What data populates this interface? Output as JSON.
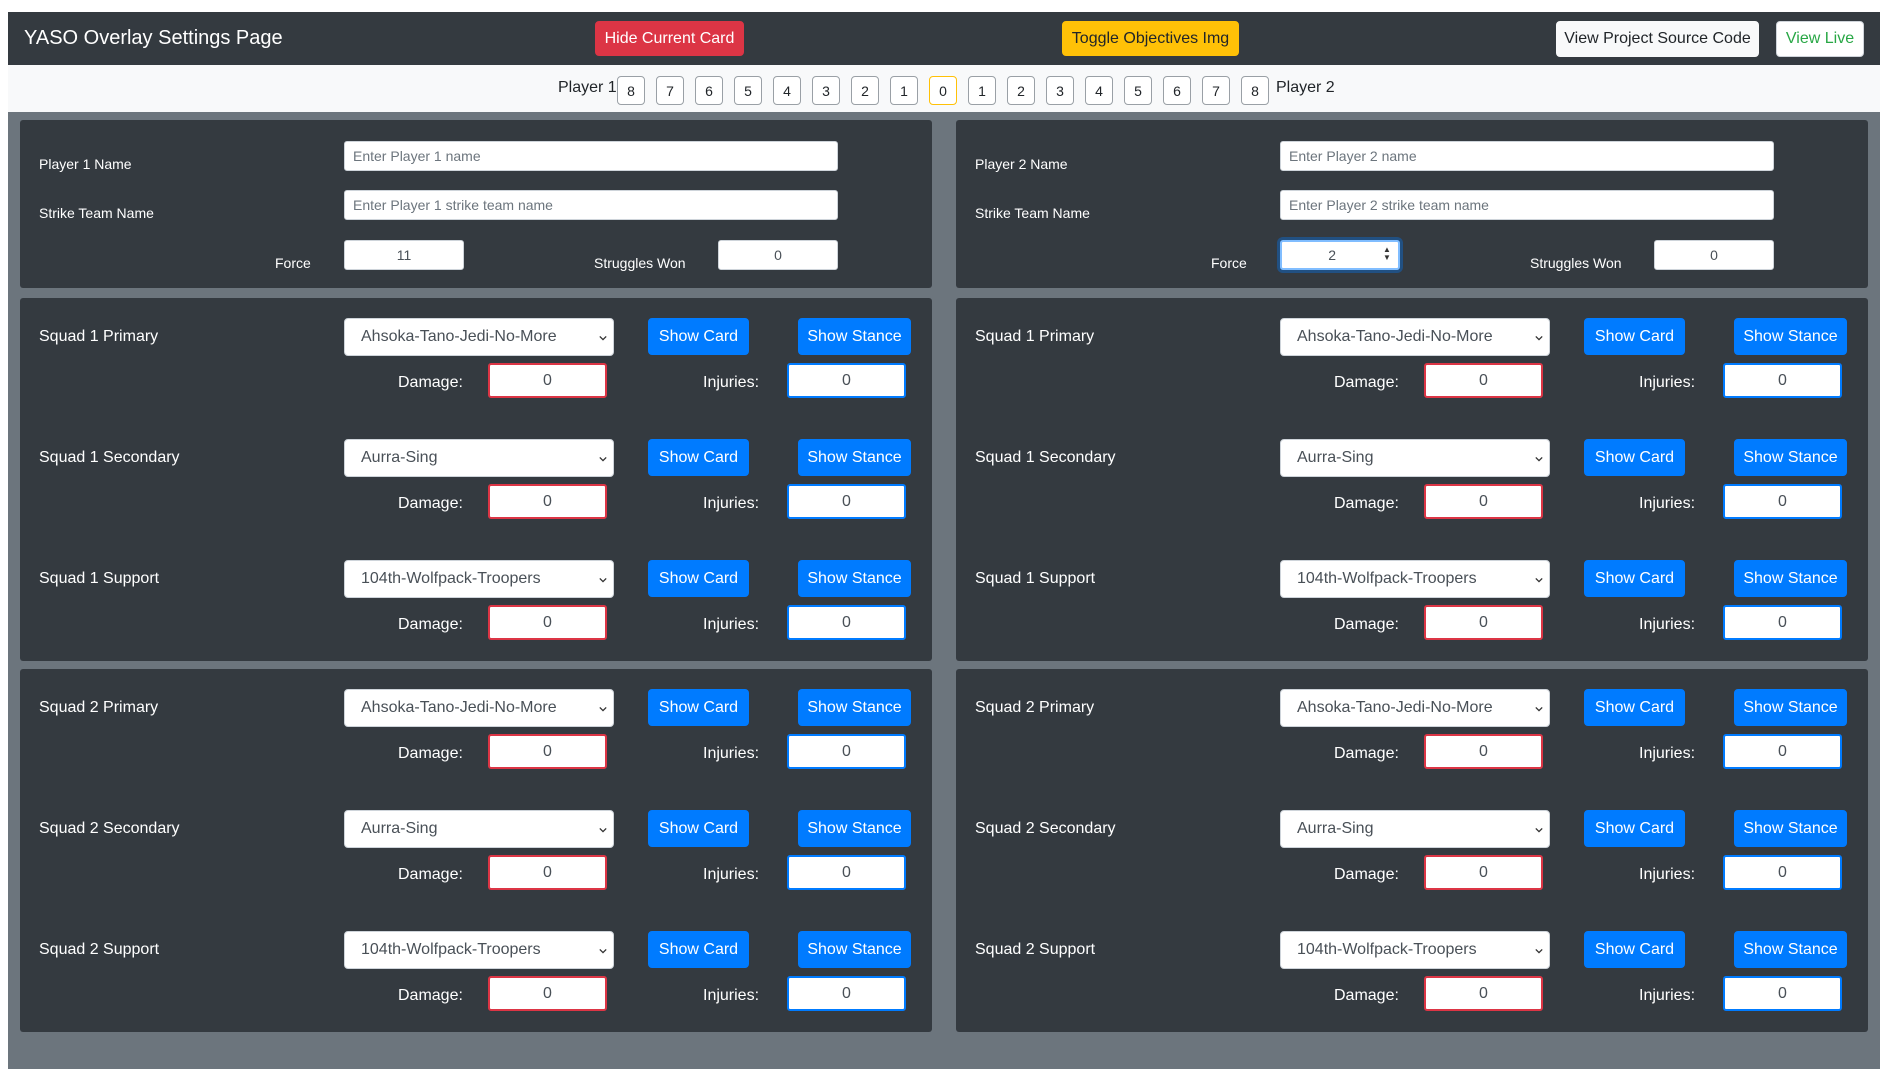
{
  "navbar": {
    "title": "YASO Overlay Settings Page",
    "hide_card_label": "Hide Current Card",
    "toggle_objectives_label": "Toggle Objectives Img",
    "view_source_label": "View Project Source Code",
    "view_live_label": "View Live"
  },
  "force_bar": {
    "left_label": "Player 1",
    "right_label": "Player 2",
    "values": [
      "8",
      "7",
      "6",
      "5",
      "4",
      "3",
      "2",
      "1",
      "0",
      "1",
      "2",
      "3",
      "4",
      "5",
      "6",
      "7",
      "8"
    ]
  },
  "players": [
    {
      "name_label": "Player 1 Name",
      "name_placeholder": "Enter Player 1 name",
      "team_label": "Strike Team Name",
      "team_placeholder": "Enter Player 1 strike team name",
      "force_label": "Force",
      "force_value": "11",
      "struggles_label": "Struggles Won",
      "struggles_value": "0",
      "units": [
        {
          "label": "Squad 1 Primary",
          "selected": "Ahsoka-Tano-Jedi-No-More",
          "damage": "0",
          "injuries": "0"
        },
        {
          "label": "Squad 1 Secondary",
          "selected": "Aurra-Sing",
          "damage": "0",
          "injuries": "0"
        },
        {
          "label": "Squad 1 Support",
          "selected": "104th-Wolfpack-Troopers",
          "damage": "0",
          "injuries": "0"
        },
        {
          "label": "Squad 2 Primary",
          "selected": "Ahsoka-Tano-Jedi-No-More",
          "damage": "0",
          "injuries": "0"
        },
        {
          "label": "Squad 2 Secondary",
          "selected": "Aurra-Sing",
          "damage": "0",
          "injuries": "0"
        },
        {
          "label": "Squad 2 Support",
          "selected": "104th-Wolfpack-Troopers",
          "damage": "0",
          "injuries": "0"
        }
      ]
    },
    {
      "name_label": "Player 2 Name",
      "name_placeholder": "Enter Player 2 name",
      "team_label": "Strike Team Name",
      "team_placeholder": "Enter Player 2 strike team name",
      "force_label": "Force",
      "force_value": "2",
      "struggles_label": "Struggles Won",
      "struggles_value": "0",
      "units": [
        {
          "label": "Squad 1 Primary",
          "selected": "Ahsoka-Tano-Jedi-No-More",
          "damage": "0",
          "injuries": "0"
        },
        {
          "label": "Squad 1 Secondary",
          "selected": "Aurra-Sing",
          "damage": "0",
          "injuries": "0"
        },
        {
          "label": "Squad 1 Support",
          "selected": "104th-Wolfpack-Troopers",
          "damage": "0",
          "injuries": "0"
        },
        {
          "label": "Squad 2 Primary",
          "selected": "Ahsoka-Tano-Jedi-No-More",
          "damage": "0",
          "injuries": "0"
        },
        {
          "label": "Squad 2 Secondary",
          "selected": "Aurra-Sing",
          "damage": "0",
          "injuries": "0"
        },
        {
          "label": "Squad 2 Support",
          "selected": "104th-Wolfpack-Troopers",
          "damage": "0",
          "injuries": "0"
        }
      ]
    }
  ],
  "unit_controls": {
    "show_card_label": "Show Card",
    "show_stance_label": "Show Stance",
    "damage_label": "Damage:",
    "injuries_label": "Injuries:"
  },
  "icons": [
    "chevron-down-icon",
    "spinner-arrows-icon"
  ],
  "colors": {
    "navbar_bg": "#343a40",
    "page_bg": "#6c757d",
    "danger": "#dc3545",
    "warning": "#ffc107",
    "primary": "#007bff",
    "success": "#28a745"
  }
}
